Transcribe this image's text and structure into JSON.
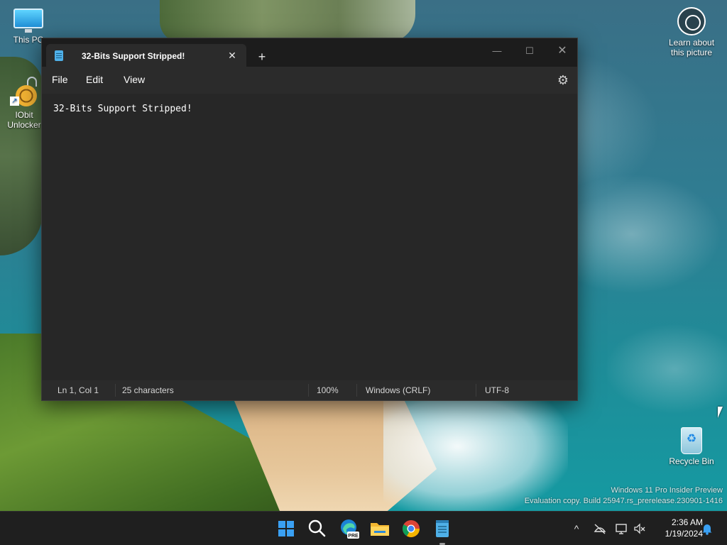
{
  "desktop": {
    "icons": [
      {
        "label": "This PC"
      },
      {
        "label": "IObit Unlocker"
      },
      {
        "label": "Learn about this picture"
      },
      {
        "label": "Recycle Bin"
      }
    ],
    "watermark": {
      "line1": "Windows 11 Pro Insider Preview",
      "line2": "Evaluation copy. Build 25947.rs_prerelease.230901-1416"
    }
  },
  "notepad": {
    "tab_title": "32-Bits Support Stripped!",
    "tab_close_glyph": "✕",
    "new_tab_glyph": "+",
    "controls": {
      "minimize": "—",
      "maximize": "☐",
      "close": "✕"
    },
    "menu": {
      "file": "File",
      "edit": "Edit",
      "view": "View"
    },
    "settings_glyph": "⚙",
    "content": "32-Bits Support Stripped!",
    "status": {
      "position": "Ln 1, Col 1",
      "characters": "25 characters",
      "zoom": "100%",
      "line_endings": "Windows (CRLF)",
      "encoding": "UTF-8"
    }
  },
  "taskbar": {
    "apps": [
      "start",
      "search",
      "edge-preview",
      "file-explorer",
      "chrome",
      "notepad"
    ],
    "edge_badge": "PRE",
    "tray": {
      "chevron": "^",
      "time": "2:36 AM",
      "date": "1/19/2024"
    }
  },
  "colors": {
    "window_bg": "#202020",
    "editor_bg": "#272727",
    "accent": "#3aa0f3"
  }
}
